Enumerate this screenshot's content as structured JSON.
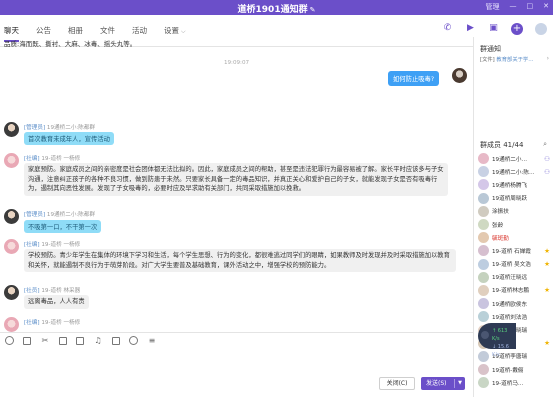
{
  "window": {
    "title": "道桥1901通知群",
    "controls": [
      "管理",
      "—",
      "□",
      "✕"
    ]
  },
  "tabs": [
    {
      "label": "聊天",
      "active": true
    },
    {
      "label": "公告"
    },
    {
      "label": "相册"
    },
    {
      "label": "文件"
    },
    {
      "label": "活动"
    },
    {
      "label": "设置"
    }
  ],
  "top_icons": [
    "phone-icon",
    "video-icon",
    "screen-share-icon",
    "add-icon",
    "avatar-icon"
  ],
  "chat": {
    "top_text": "品质:海而既、撕衬、大麻、冰毒、摇头丸等。",
    "time": "19:09:07",
    "self_message": "如何防止吸毒?",
    "messages": [
      {
        "role": "[管理员]",
        "sender": " 19通桥二小:陈都群",
        "text": "首次教育未成年人，宣传活动",
        "style": "blue",
        "avatar": "teacher"
      },
      {
        "role": "[社编]",
        "sender": " 19-道桥 一杨修",
        "text": "家庭预防。家庭成员之间的亲密度是社会团体都无法比拟的。因此，家庭成员之间的帮助，甚至是违法犯罪行为最容易被了解。家长平时应该多与子女沟通，注意纠正孩子的各种不良习惯，做到防患于未然。只要家长具备一定的毒品知识，并真正关心和爱护自己的子女，就能发现子女是否有吸毒行为，遏制其向恶性发展。发现了子女吸毒的，必要时应及早求助有关部门，共同采取措施加以挽救。",
        "style": "grey",
        "avatar": "student"
      },
      {
        "role": "[管理员]",
        "sender": " 19通桥二小:陈都群",
        "text": "不吸第一口，不干第一次",
        "style": "blue",
        "avatar": "teacher"
      },
      {
        "role": "[社编]",
        "sender": " 19-道桥 一杨修",
        "text": "学校预防。青少年学生在集体的环境下学习和生活，每个学生思想、行为的变化，都很难逃过同学们的眼睛，如果教师及时发现并及时采取措施加以教育和关怀，就能遏制不良行为于萌芽阶段。对广大学生要普及基础教育，课外活动之中，增强学校的预防能力。",
        "style": "grey",
        "avatar": "student"
      },
      {
        "role": "[社员]",
        "sender": " 19-道桥 林采器",
        "text": "远离毒品，人人有责",
        "style": "grey",
        "avatar": "teacher"
      },
      {
        "role": "[社编]",
        "sender": " 19-道桥 一杨修",
        "text": "",
        "style": "grey",
        "avatar": "student"
      }
    ]
  },
  "toolbar_icons": [
    "emoji-icon",
    "gif-icon",
    "scissors-icon",
    "folder-icon",
    "image-icon",
    "music-icon",
    "screenshot-icon",
    "voice-icon",
    "more-icon"
  ],
  "buttons": {
    "close": "关闭(C)",
    "send": "发送(S)"
  },
  "right_panel": {
    "notice_title": "群通知",
    "notice_tag": "[文件]",
    "notice_text": "教育部关于学…",
    "members_label": "群成员 41/44",
    "members": [
      {
        "name": "19通桥二小…",
        "icon": "person",
        "color": "#e7b9c7"
      },
      {
        "name": "19通桥二小:陈…",
        "icon": "person",
        "color": "#c8d1e4"
      },
      {
        "name": "19通桥杨腾飞",
        "icon": "",
        "color": "#d4c7e8"
      },
      {
        "name": "19道桥周晓跃",
        "icon": "",
        "color": "#b9c8d6"
      },
      {
        "name": "涂振扶",
        "icon": "",
        "color": "#d0cbc0"
      },
      {
        "name": "张龄",
        "icon": "",
        "color": "#cfd9c2"
      },
      {
        "name": "毓斑勤",
        "icon": "",
        "color": "#e3c9b0",
        "red": true
      },
      {
        "name": "19-道桥 石婵霞",
        "icon": "star",
        "color": "#d6bfcf"
      },
      {
        "name": "19-道桥 吴文浩",
        "icon": "star",
        "color": "#bdcde0"
      },
      {
        "name": "19道桥汪晓远",
        "icon": "",
        "color": "#c5d2be"
      },
      {
        "name": "19-道桥林志鹏",
        "icon": "star",
        "color": "#e0cfbe"
      },
      {
        "name": "19通桥欧侯东",
        "icon": "",
        "color": "#c9c4df"
      },
      {
        "name": "19道桥刘法浩",
        "icon": "",
        "color": "#b9d0d8"
      },
      {
        "name": "19道桥滑晓瑞",
        "icon": "",
        "color": "#e5d2c4"
      },
      {
        "name": "徐九说",
        "icon": "star",
        "color": "#d7c8b6"
      },
      {
        "name": "19道桥李唐瑞",
        "icon": "",
        "color": "#c2cbd9"
      },
      {
        "name": "19道桥-戴俪",
        "icon": "",
        "color": "#d9c3c9"
      },
      {
        "name": "19-道桥马…",
        "icon": "",
        "color": "#c9d6c5"
      }
    ]
  },
  "float_badge": {
    "up": "↑ 613",
    "unit_up": "K/s",
    "down": "↓ 15.6",
    "unit_down": "K/s"
  }
}
